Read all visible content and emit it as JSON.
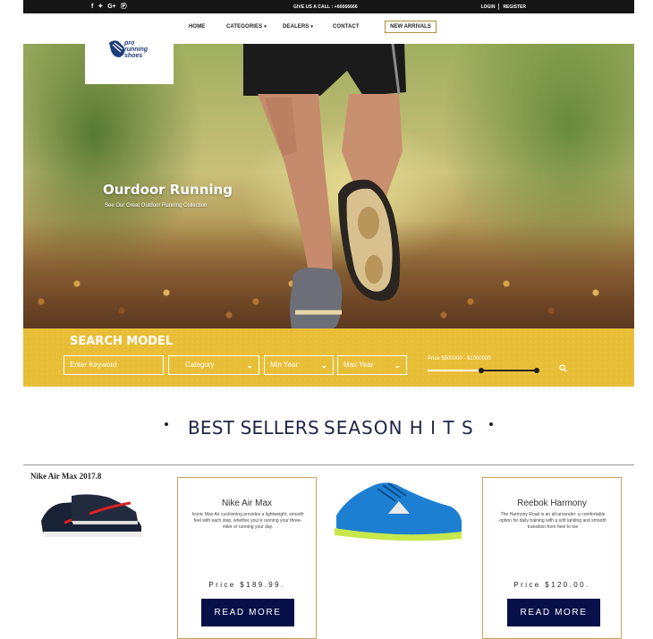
{
  "topbar": {
    "social_icons": [
      "facebook-icon",
      "twitter-icon",
      "google-plus-icon",
      "pinterest-icon"
    ],
    "social_glyphs": [
      "f",
      "✦",
      "G+",
      "Ⓟ"
    ],
    "call_text": "GIVE US A CALL : +66666666",
    "login": "LOGIN",
    "register": "REGISTER"
  },
  "nav": {
    "home": "HOME",
    "categories": "CATEGORIES",
    "dealers": "DEALERS",
    "contact": "CONTACT",
    "new_arrivals": "NEW ARRIVALS",
    "caret": "▾"
  },
  "logo": {
    "line1": "pro",
    "line2": "running",
    "line3": "shoes"
  },
  "hero": {
    "title": "Ourdoor Running",
    "subtitle": "See Our Great Outdoor Running Collection"
  },
  "search": {
    "title": "SEARCH MODEL",
    "keyword_placeholder": "Enter Keyword",
    "category": "Category",
    "min_year": "Min Year",
    "max_year": "Max Year",
    "price_label": "Price $500000 - $1000000",
    "price_min": 500000,
    "price_max": 1000000,
    "chevron": "⌄"
  },
  "best_sellers": {
    "left": "BEST SELLERS",
    "right": "SEASON H I T S"
  },
  "products": {
    "p1_name": "Nike Air Max 2017.8",
    "card1": {
      "title": "Nike Air Max",
      "desc": "Iconic Max Air cushioning provides a lightweight, smooth feel with each step, whether you're running your three-miler or running your day.",
      "price": "Price $189.99.",
      "button": "READ MORE"
    },
    "card2": {
      "title": "Reebok Harmony",
      "desc": "The Harmony Road is an all-arounder: a comfortable option for daily training with a soft landing and smooth transition from heel to toe",
      "price": "Price $120.00.",
      "button": "READ MORE"
    }
  },
  "colors": {
    "accent_yellow": "#e8be37",
    "button_navy": "#08104a",
    "card_border": "#c8a25a",
    "heading": "#1e2445"
  }
}
